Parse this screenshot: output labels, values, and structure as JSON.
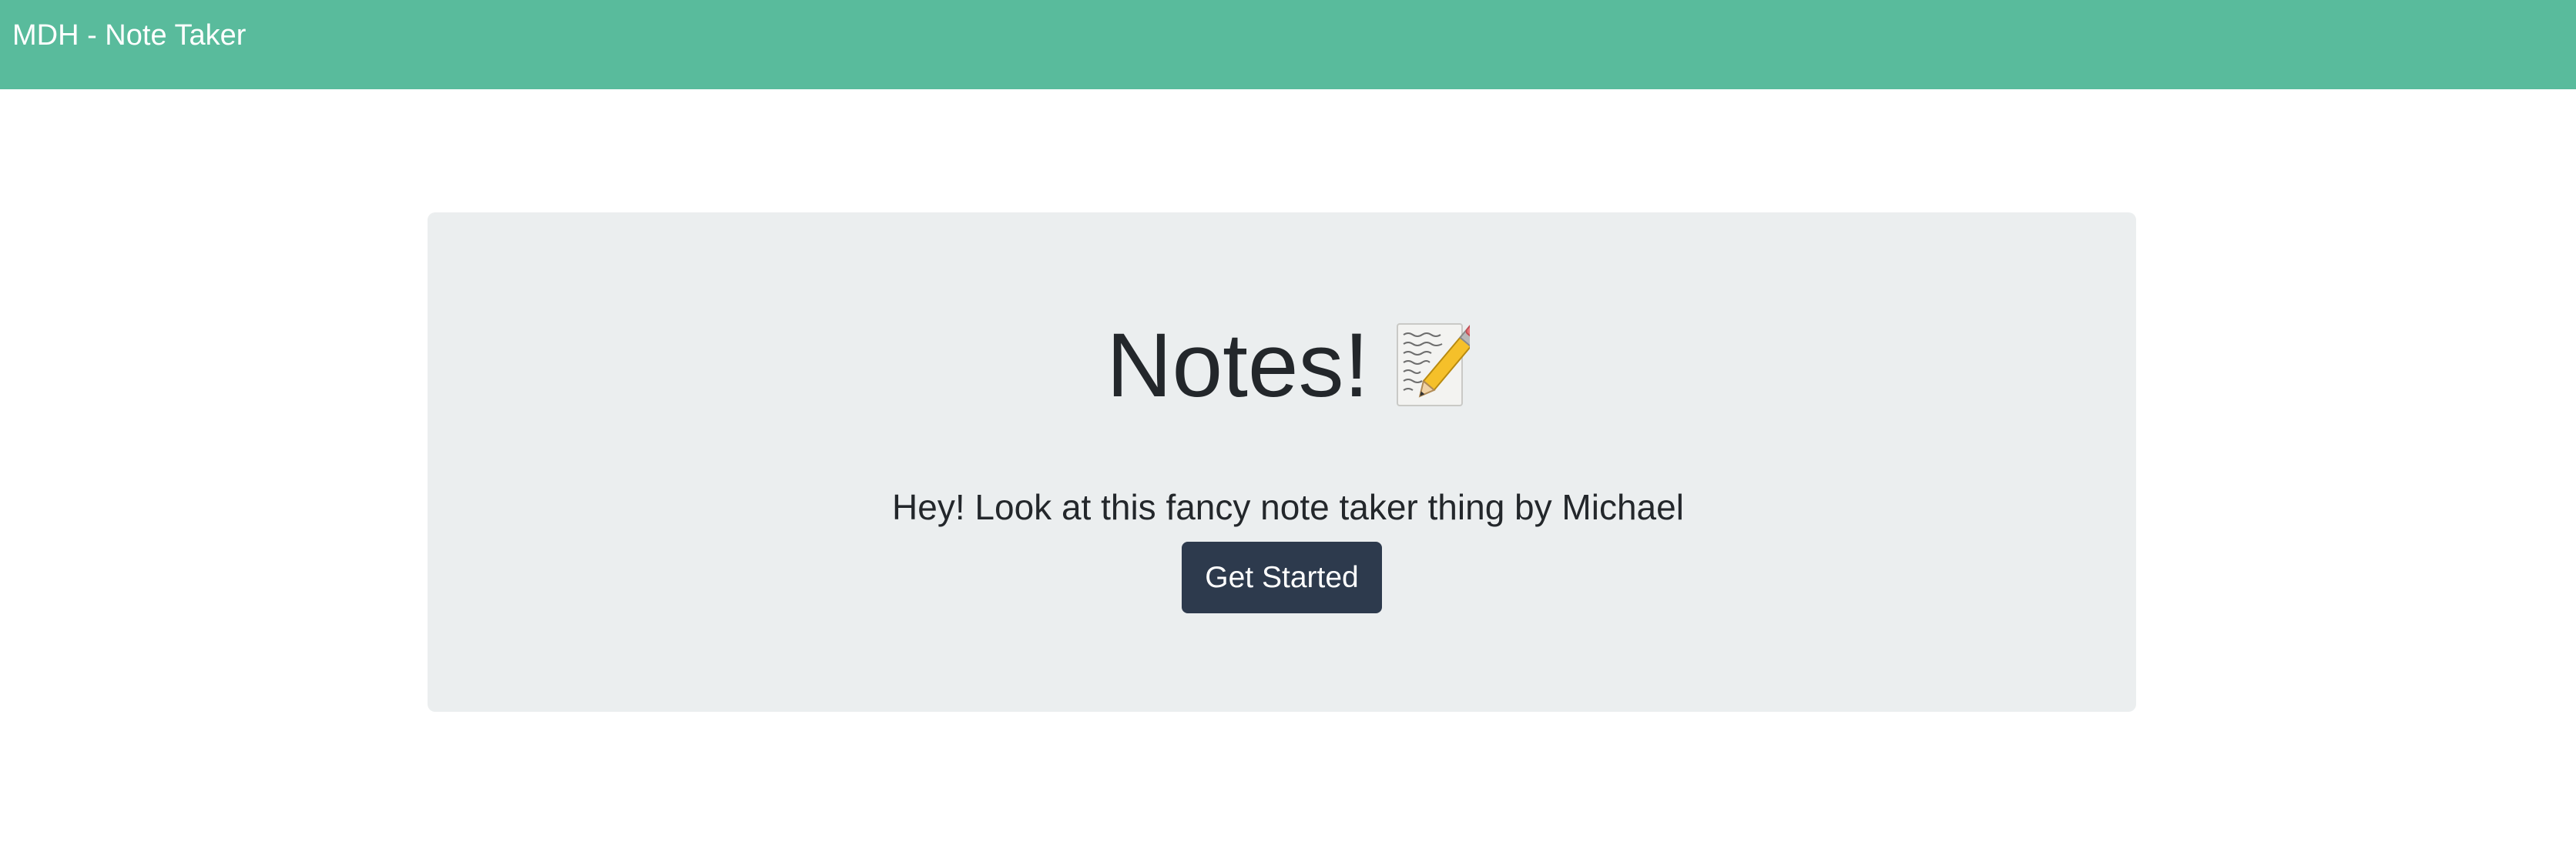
{
  "navbar": {
    "brand": "MDH - Note Taker",
    "background_color": "#59bb9c"
  },
  "hero": {
    "title": "Notes!",
    "title_icon": "memo-pencil-icon",
    "lead": "Hey! Look at this fancy note taker thing by Michael",
    "button_label": "Get Started",
    "button_color": "#2d3a4d",
    "panel_color": "#ebeeef"
  }
}
